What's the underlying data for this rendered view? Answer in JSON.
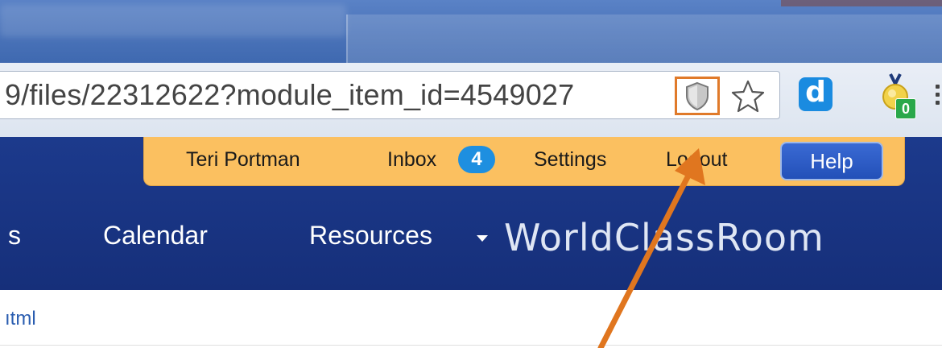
{
  "browser": {
    "url": "9/files/22312622?module_item_id=4549027",
    "icons": {
      "shield": "shield-icon",
      "star": "star-icon",
      "extension_d": "d-extension-icon",
      "extension_medal": "medal-extension-icon",
      "menu": "menu-icon"
    },
    "extension_d_label": "d",
    "medal_badge": "0"
  },
  "userbar": {
    "user_name": "Teri Portman",
    "inbox_label": "Inbox",
    "inbox_count": "4",
    "settings_label": "Settings",
    "logout_label": "Logout",
    "help_label": "Help"
  },
  "nav": {
    "partial_item": "s",
    "calendar_label": "Calendar",
    "resources_label": "Resources"
  },
  "brand": "WorldClassRoom",
  "breadcrumb": "ıtml",
  "colors": {
    "highlight": "#e07a2a",
    "navy": "#1c3a8c",
    "userbar": "#fbc060",
    "badge": "#1e8fe0"
  }
}
